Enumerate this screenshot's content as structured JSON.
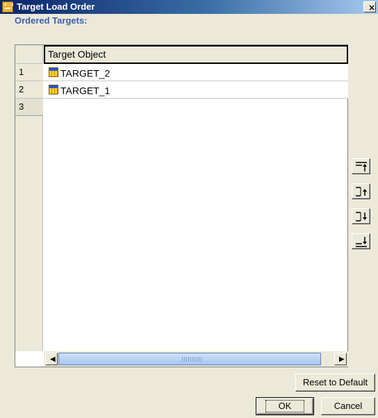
{
  "window": {
    "title": "Target Load Order",
    "close_glyph": "×",
    "icon": "app-icon"
  },
  "section_label": "Ordered Targets:",
  "grid": {
    "column_header": "Target Object",
    "rows": [
      {
        "num": "1",
        "target": "TARGET_2",
        "icon": "target-table-icon"
      },
      {
        "num": "2",
        "target": "TARGET_1",
        "icon": "target-table-icon"
      },
      {
        "num": "3",
        "target": ""
      }
    ]
  },
  "scrollbar": {
    "left_arrow": "◀",
    "right_arrow": "▶"
  },
  "move_buttons": [
    {
      "name": "move-to-top-icon"
    },
    {
      "name": "move-up-icon"
    },
    {
      "name": "move-down-icon"
    },
    {
      "name": "move-to-bottom-icon"
    }
  ],
  "buttons": {
    "reset": "Reset to Default",
    "ok": "OK",
    "cancel": "Cancel"
  }
}
